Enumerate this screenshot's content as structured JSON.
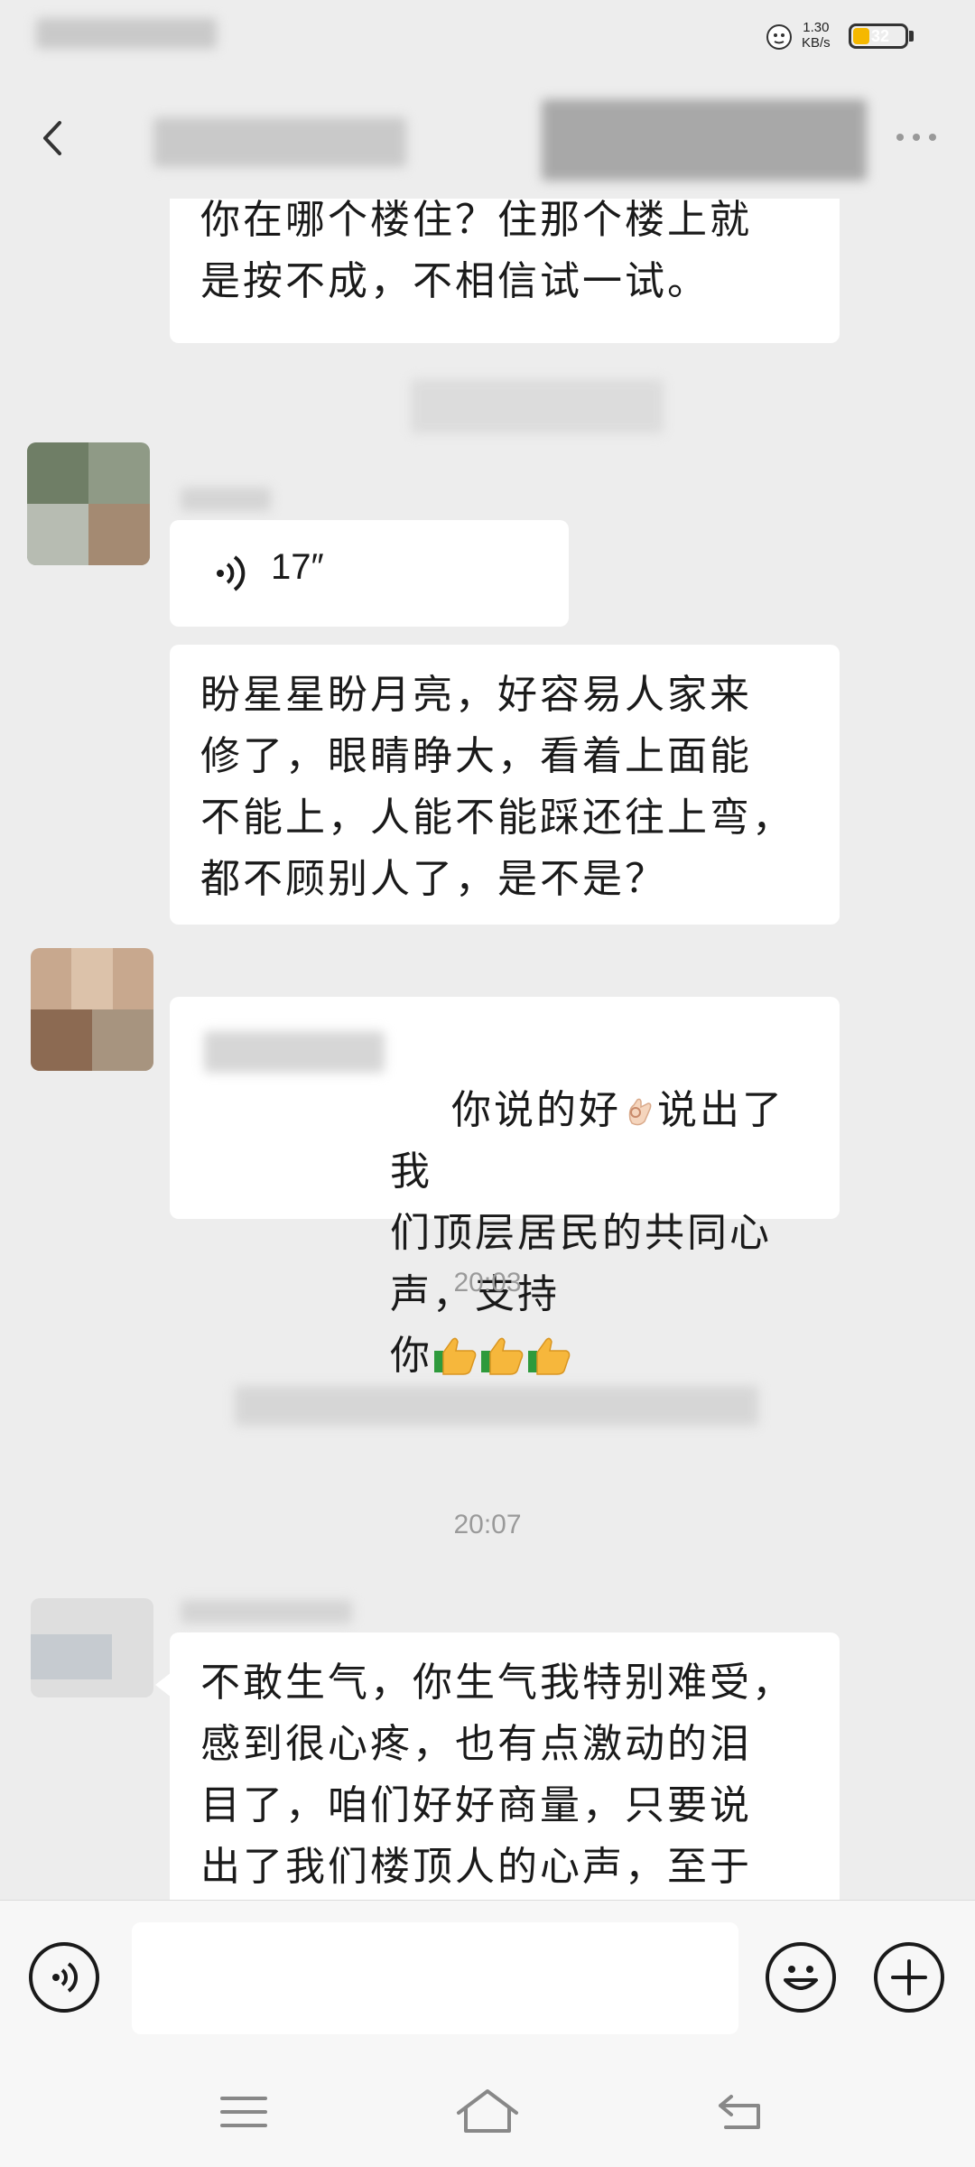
{
  "status_bar": {
    "net_speed_value": "1.30",
    "net_speed_unit": "KB/s",
    "battery_level": "32",
    "battery_fill_fraction": 0.32
  },
  "chat": {
    "messages": [
      {
        "text": "你在哪个楼住？住那个楼上就\n是按不成，不相信试一试。"
      },
      {
        "voice_duration": "17″"
      },
      {
        "text": "盼星星盼月亮，好容易人家来\n修了，眼睛睁大，看着上面能\n不能上，人能不能踩还往上弯，\n都不顾别人了，是不是？"
      },
      {
        "text_before_emoji": "你说的好",
        "text_after_emoji": "说出了我\n们顶层居民的共同心声，支持\n你"
      },
      {
        "text": "不敢生气，你生气我特别难受，\n感到很心疼，也有点激动的泪\n目了，咱们好好商量，只要说\n出了我们楼顶人的心声，至于"
      }
    ],
    "timestamps": [
      "20:03",
      "20:07"
    ]
  },
  "colors": {
    "background": "#ededed",
    "bubble": "#ffffff",
    "battery": "#f5b800",
    "thumbs_up": "#f6b73c",
    "thumbs_up_cuff": "#2e9a3c"
  }
}
